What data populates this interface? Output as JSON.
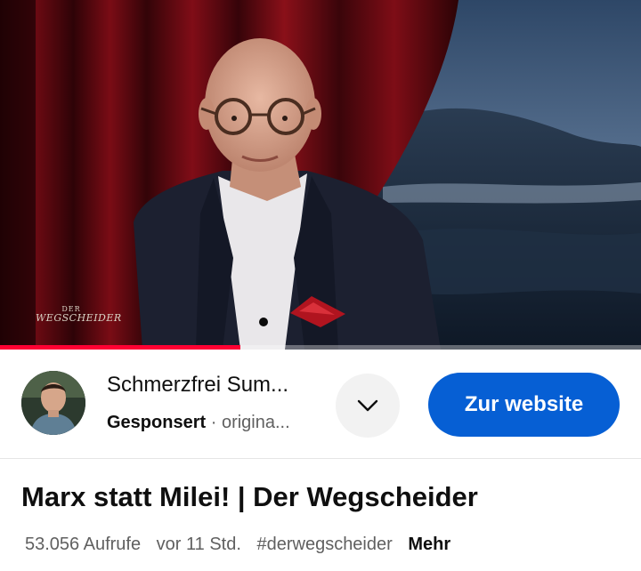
{
  "video": {
    "watermark_top": "DER",
    "watermark_main": "WEGSCHEIDER",
    "progress_fraction": 0.375
  },
  "ad": {
    "channel_name": "Schmerzfrei Sum...",
    "sponsored_label": "Gesponsert",
    "separator": "·",
    "origin_text": "origina...",
    "cta_label": "Zur website",
    "icons": {
      "expand": "chevron-down-icon"
    },
    "colors": {
      "cta_background": "#065fd4",
      "progress": "#ff0033"
    }
  },
  "video_info": {
    "title": "Marx statt Milei! | Der Wegscheider",
    "views": "53.056 Aufrufe",
    "age": "vor 11 Std.",
    "hashtag": "#derwegscheider",
    "more_label": "Mehr"
  }
}
